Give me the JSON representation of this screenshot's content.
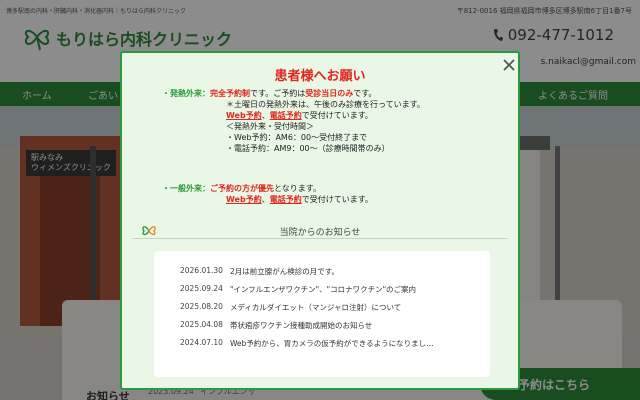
{
  "header": {
    "tagline": "博多駅南の内科・肝臓内科・消化器内科｜もりはら内科クリニック",
    "address": "〒812-0016 福岡県福岡市博多区博多駅南6丁目1番7号",
    "logo_text": "もりはら内科クリニック",
    "phone": "092-477-1012",
    "email": "s.naikacl@gmail.com"
  },
  "nav": {
    "home": "ホーム",
    "partial": "ごあい",
    "faq": "よくあるご質問"
  },
  "hero": {
    "sign_line1": "駅みなみ",
    "sign_line2": "ウィメンズクリニック"
  },
  "background_news": {
    "title": "お知らせ",
    "item": "2025.09.24 \"インフルエンザ"
  },
  "reserve_button": "予約はこちら",
  "modal": {
    "title": "患者様へお願い",
    "fever": {
      "heading": "発熱外来：",
      "policy_prefix": "完全予約制",
      "policy_mid": "です。ご予約は",
      "policy_em": "受診当日のみ",
      "policy_suffix": "です。",
      "saturday_note": "＊土曜日の発熱外来は、午後のみ診療を行っています。",
      "web": "Web予約",
      "sep": "、",
      "phone": "電話予約",
      "accept": "で受付けています。",
      "hours_header": "＜発熱外来・受付時間＞",
      "web_hours": "・Web予約：AM6：00～受付終了まで",
      "phone_hours": "・電話予約：AM9：00～（診療時間帯のみ）"
    },
    "general": {
      "heading": "一般外来：",
      "priority": "ご予約の方が優先",
      "priority_suffix": "となります。",
      "web": "Web予約",
      "sep": "、",
      "phone": "電話予約",
      "accept": "で受付けています。"
    },
    "info_title": "当院からのお知らせ",
    "news": [
      {
        "date": "2026.01.30",
        "text": "2月は前立腺がん検診の月です。"
      },
      {
        "date": "2025.09.24",
        "text": "\"インフルエンザワクチン\"、\"コロナワクチン\"のご案内"
      },
      {
        "date": "2025.08.20",
        "text": "メディカルダイエット（マンジャロ注射）について"
      },
      {
        "date": "2025.04.08",
        "text": "帯状疱疹ワクチン接種助成開始のお知らせ"
      },
      {
        "date": "2024.07.10",
        "text": "Web予約から、胃カメラの仮予約ができるようになりまし…"
      }
    ]
  },
  "colors": {
    "brand_green": "#2a9a3c",
    "alert_red": "#e0261e",
    "modal_bg": "#eaf7e6"
  },
  "icons": {
    "close": "close-icon",
    "phone": "phone-icon",
    "logo": "clover-logo-icon"
  }
}
